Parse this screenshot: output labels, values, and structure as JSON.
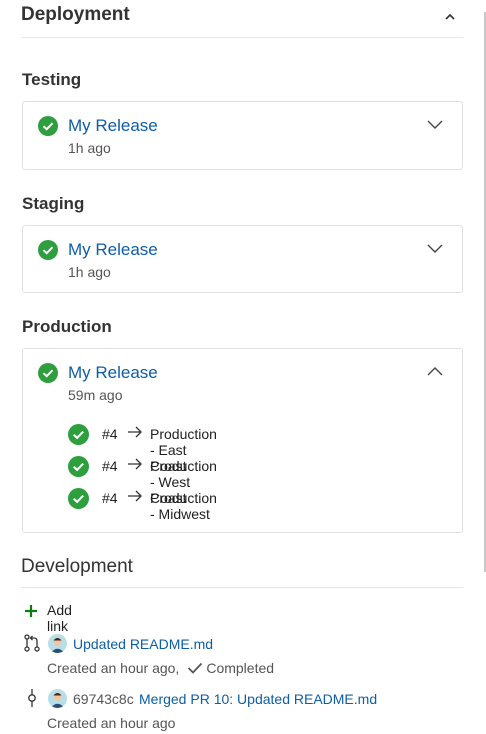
{
  "deployment": {
    "title": "Deployment",
    "stages": [
      {
        "stage": "Testing",
        "release_name": "My Release",
        "time": "1h ago",
        "expanded": false
      },
      {
        "stage": "Staging",
        "release_name": "My Release",
        "time": "1h ago",
        "expanded": false
      },
      {
        "stage": "Production",
        "release_name": "My Release",
        "time": "59m ago",
        "expanded": true,
        "environments": [
          {
            "number": "#4",
            "environment": "Production - East Coast"
          },
          {
            "number": "#4",
            "environment": "Production - West Coast"
          },
          {
            "number": "#4",
            "environment": "Production - Midwest"
          }
        ]
      }
    ]
  },
  "development": {
    "title": "Development",
    "add_link_label": "Add link",
    "items": [
      {
        "type": "pull-request",
        "title": "Updated README.md",
        "created": "Created an hour ago,",
        "status": "Completed"
      },
      {
        "type": "commit",
        "commit_id": "69743c8c",
        "title": "Merged PR 10: Updated README.md",
        "created": "Created an hour ago"
      }
    ]
  },
  "colors": {
    "success": "#2e9e3f",
    "link": "#0d5ea6",
    "add": "#107c10"
  },
  "icons": [
    "chevron-up-icon",
    "chevron-down-icon",
    "success-check-icon",
    "arrow-right-icon",
    "plus-icon",
    "pull-request-icon",
    "commit-icon",
    "user-avatar",
    "checkmark-icon"
  ]
}
